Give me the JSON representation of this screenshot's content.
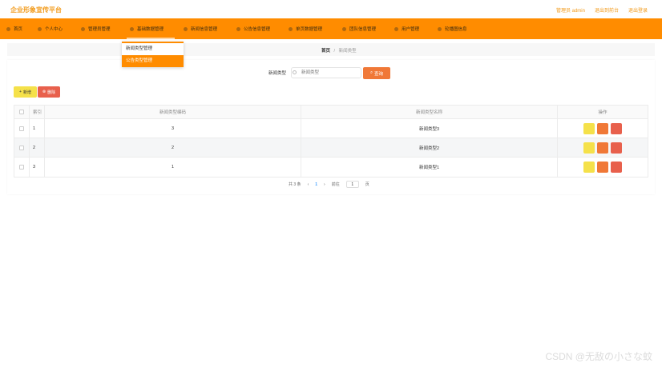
{
  "app": {
    "title": "企业形象宣传平台"
  },
  "topbar": {
    "user_greeting": "管理员 admin",
    "back_to_admin": "退出到前台",
    "logout": "退出登录"
  },
  "nav": {
    "items": [
      {
        "label": "首页",
        "icon": "home-icon"
      },
      {
        "label": "个人中心",
        "icon": "user-icon"
      },
      {
        "label": "管理员管理",
        "icon": "admin-icon"
      },
      {
        "label": "基础数据管理",
        "icon": "data-icon"
      },
      {
        "label": "新闻信息管理",
        "icon": "news-icon"
      },
      {
        "label": "公告信息管理",
        "icon": "notice-icon"
      },
      {
        "label": "单页数据管理",
        "icon": "page-icon"
      },
      {
        "label": "团队信息管理",
        "icon": "team-icon"
      },
      {
        "label": "用户管理",
        "icon": "users-icon"
      },
      {
        "label": "轮播图信息",
        "icon": "carousel-icon"
      }
    ],
    "dropdown": [
      "新闻类型管理",
      "公告类型管理"
    ]
  },
  "breadcrumb": {
    "home": "首页",
    "separator": "/",
    "current": "新闻类型"
  },
  "search": {
    "label": "新闻类型",
    "placeholder": "新闻类型",
    "button": "查询"
  },
  "actions": {
    "add": "新增",
    "delete": "删除"
  },
  "table": {
    "headers": [
      "索引",
      "新闻类型编码",
      "新闻类型名称",
      "操作"
    ],
    "rows": [
      {
        "index": "1",
        "code": "3",
        "name": "新闻类型3"
      },
      {
        "index": "2",
        "code": "2",
        "name": "新闻类型2"
      },
      {
        "index": "3",
        "code": "1",
        "name": "新闻类型1"
      }
    ]
  },
  "pagination": {
    "total": "共 3 条",
    "prev": "‹",
    "current_page": "1",
    "next": "›",
    "goto_label": "前往",
    "goto_value": "1",
    "page_suffix": "页"
  },
  "watermark": "CSDN @无敌の小さな蚊",
  "colors": {
    "accent": "#ff8c00",
    "brand_text": "#f29b1c",
    "search_button": "#f07837",
    "add_button": "#f5e14a",
    "delete_button": "#e8604c"
  }
}
